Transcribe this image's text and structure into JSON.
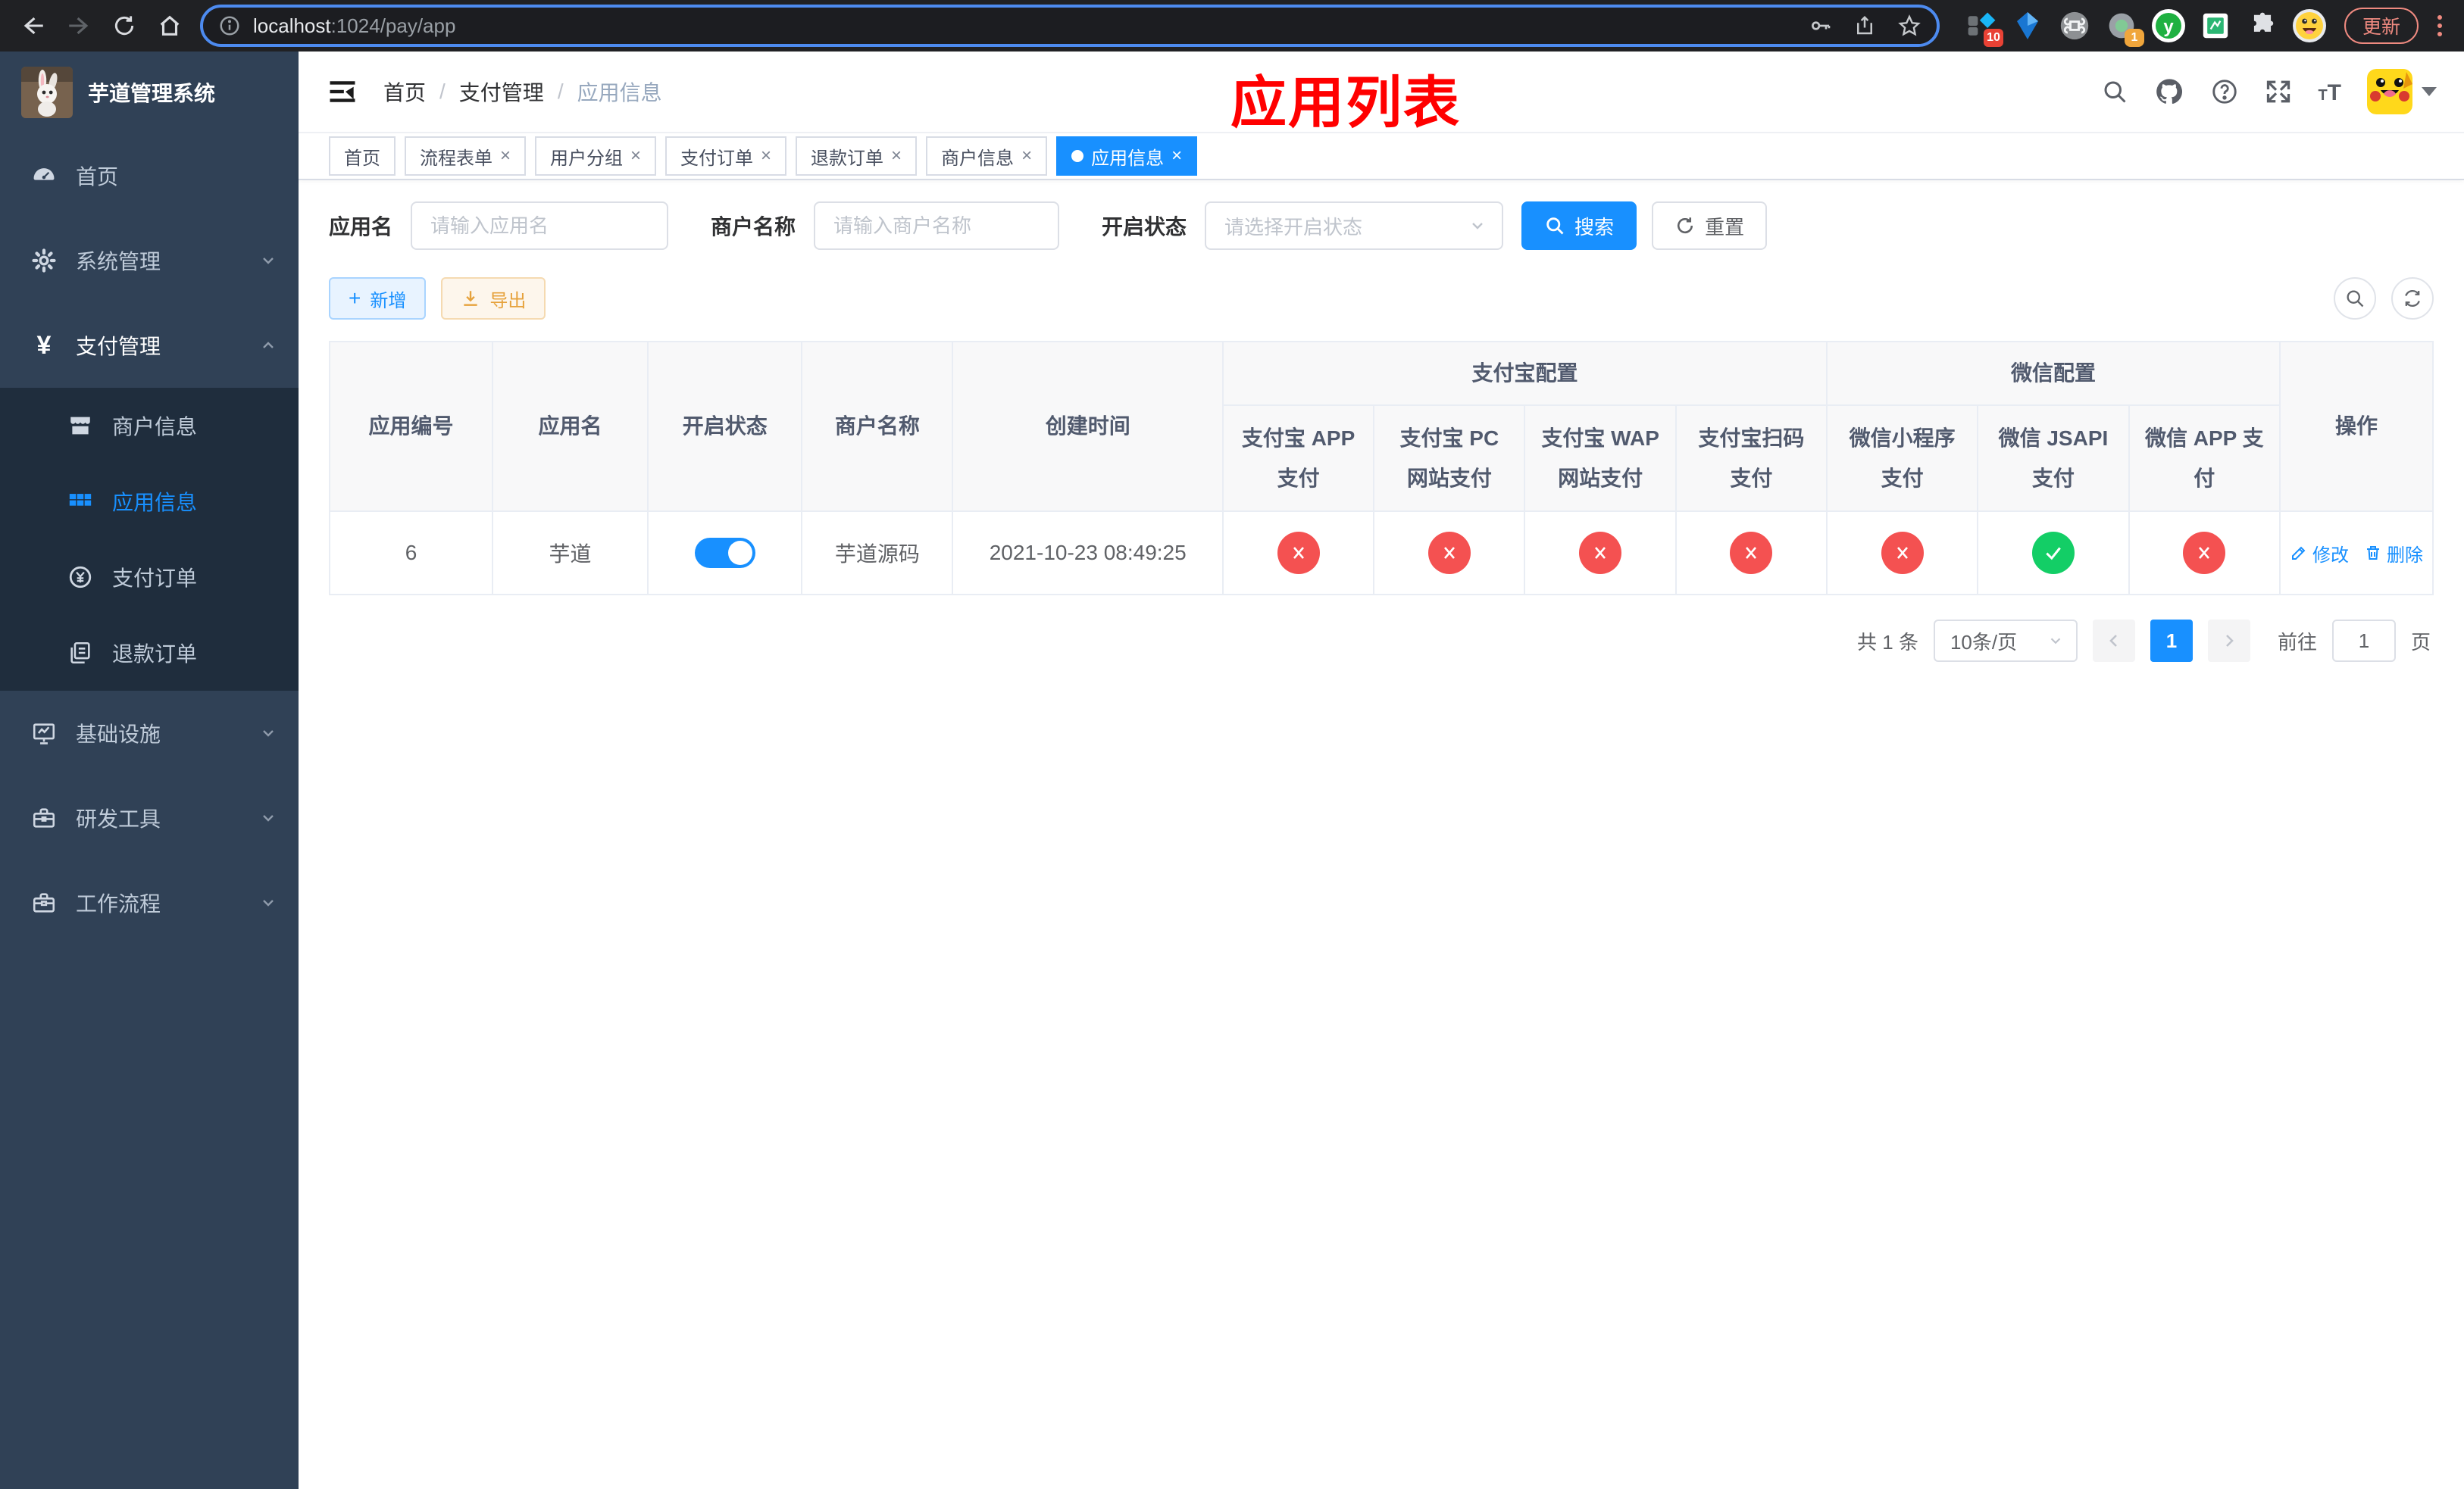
{
  "browser": {
    "url": {
      "host": "localhost",
      "rest": ":1024/pay/app"
    },
    "update_button": "更新",
    "extensions": {
      "badge_red": "10",
      "badge_orange": "1",
      "y_logo": "y"
    }
  },
  "sidebar": {
    "title": "芋道管理系统",
    "items": [
      {
        "label": "首页"
      },
      {
        "label": "系统管理"
      },
      {
        "label": "支付管理"
      },
      {
        "label": "基础设施"
      },
      {
        "label": "研发工具"
      },
      {
        "label": "工作流程"
      }
    ],
    "sub_items": [
      {
        "label": "商户信息"
      },
      {
        "label": "应用信息"
      },
      {
        "label": "支付订单"
      },
      {
        "label": "退款订单"
      }
    ]
  },
  "header": {
    "breadcrumb": [
      "首页",
      "支付管理",
      "应用信息"
    ],
    "annotation": "应用列表"
  },
  "tabs": [
    {
      "label": "首页"
    },
    {
      "label": "流程表单"
    },
    {
      "label": "用户分组"
    },
    {
      "label": "支付订单"
    },
    {
      "label": "退款订单"
    },
    {
      "label": "商户信息"
    },
    {
      "label": "应用信息"
    }
  ],
  "filters": {
    "app_name_label": "应用名",
    "app_name_placeholder": "请输入应用名",
    "merchant_label": "商户名称",
    "merchant_placeholder": "请输入商户名称",
    "status_label": "开启状态",
    "status_placeholder": "请选择开启状态",
    "search_button": "搜索",
    "reset_button": "重置"
  },
  "toolbar": {
    "add_button": "新增",
    "export_button": "导出"
  },
  "table": {
    "main_columns": [
      "应用编号",
      "应用名",
      "开启状态",
      "商户名称",
      "创建时间"
    ],
    "groups": [
      "支付宝配置",
      "微信配置"
    ],
    "sub_columns": [
      "支付宝 APP 支付",
      "支付宝 PC 网站支付",
      "支付宝 WAP 网站支付",
      "支付宝扫码支付",
      "微信小程序支付",
      "微信 JSAPI 支付",
      "微信 APP 支付"
    ],
    "op_column": "操作",
    "row": {
      "id": "6",
      "name": "芋道",
      "enabled": true,
      "merchant": "芋道源码",
      "created": "2021-10-23 08:49:25",
      "statuses": [
        "close",
        "close",
        "close",
        "close",
        "close",
        "check",
        "close"
      ],
      "edit": "修改",
      "delete": "删除"
    }
  },
  "pagination": {
    "total": "共 1 条",
    "page_size": "10条/页",
    "page": "1",
    "goto": "前往",
    "goto_value": "1",
    "unit": "页"
  },
  "icons": {
    "close": "×",
    "plus": "+",
    "yuan": "¥"
  },
  "colors": {
    "primary": "#1890ff",
    "success": "#13ce66",
    "danger": "#f45151",
    "sidebar_bg": "#304156",
    "submenu_bg": "#1f2d3d"
  }
}
